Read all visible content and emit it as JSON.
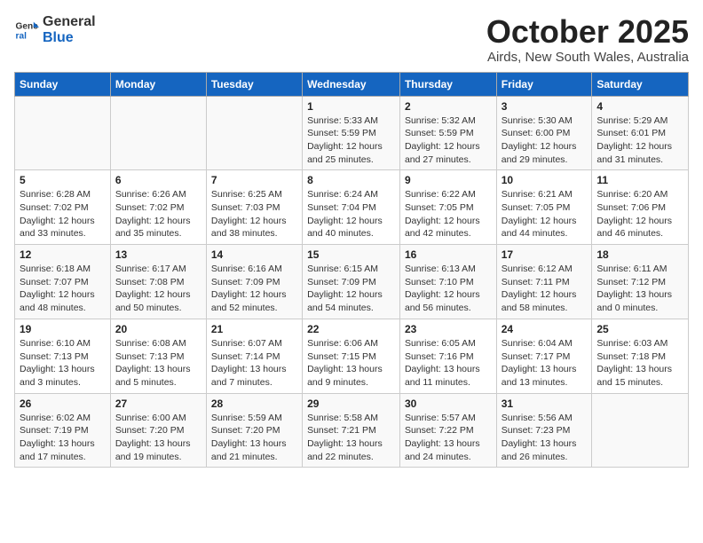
{
  "header": {
    "logo_line1": "General",
    "logo_line2": "Blue",
    "month": "October 2025",
    "location": "Airds, New South Wales, Australia"
  },
  "weekdays": [
    "Sunday",
    "Monday",
    "Tuesday",
    "Wednesday",
    "Thursday",
    "Friday",
    "Saturday"
  ],
  "weeks": [
    [
      {
        "day": "",
        "detail": ""
      },
      {
        "day": "",
        "detail": ""
      },
      {
        "day": "",
        "detail": ""
      },
      {
        "day": "1",
        "detail": "Sunrise: 5:33 AM\nSunset: 5:59 PM\nDaylight: 12 hours\nand 25 minutes."
      },
      {
        "day": "2",
        "detail": "Sunrise: 5:32 AM\nSunset: 5:59 PM\nDaylight: 12 hours\nand 27 minutes."
      },
      {
        "day": "3",
        "detail": "Sunrise: 5:30 AM\nSunset: 6:00 PM\nDaylight: 12 hours\nand 29 minutes."
      },
      {
        "day": "4",
        "detail": "Sunrise: 5:29 AM\nSunset: 6:01 PM\nDaylight: 12 hours\nand 31 minutes."
      }
    ],
    [
      {
        "day": "5",
        "detail": "Sunrise: 6:28 AM\nSunset: 7:02 PM\nDaylight: 12 hours\nand 33 minutes."
      },
      {
        "day": "6",
        "detail": "Sunrise: 6:26 AM\nSunset: 7:02 PM\nDaylight: 12 hours\nand 35 minutes."
      },
      {
        "day": "7",
        "detail": "Sunrise: 6:25 AM\nSunset: 7:03 PM\nDaylight: 12 hours\nand 38 minutes."
      },
      {
        "day": "8",
        "detail": "Sunrise: 6:24 AM\nSunset: 7:04 PM\nDaylight: 12 hours\nand 40 minutes."
      },
      {
        "day": "9",
        "detail": "Sunrise: 6:22 AM\nSunset: 7:05 PM\nDaylight: 12 hours\nand 42 minutes."
      },
      {
        "day": "10",
        "detail": "Sunrise: 6:21 AM\nSunset: 7:05 PM\nDaylight: 12 hours\nand 44 minutes."
      },
      {
        "day": "11",
        "detail": "Sunrise: 6:20 AM\nSunset: 7:06 PM\nDaylight: 12 hours\nand 46 minutes."
      }
    ],
    [
      {
        "day": "12",
        "detail": "Sunrise: 6:18 AM\nSunset: 7:07 PM\nDaylight: 12 hours\nand 48 minutes."
      },
      {
        "day": "13",
        "detail": "Sunrise: 6:17 AM\nSunset: 7:08 PM\nDaylight: 12 hours\nand 50 minutes."
      },
      {
        "day": "14",
        "detail": "Sunrise: 6:16 AM\nSunset: 7:09 PM\nDaylight: 12 hours\nand 52 minutes."
      },
      {
        "day": "15",
        "detail": "Sunrise: 6:15 AM\nSunset: 7:09 PM\nDaylight: 12 hours\nand 54 minutes."
      },
      {
        "day": "16",
        "detail": "Sunrise: 6:13 AM\nSunset: 7:10 PM\nDaylight: 12 hours\nand 56 minutes."
      },
      {
        "day": "17",
        "detail": "Sunrise: 6:12 AM\nSunset: 7:11 PM\nDaylight: 12 hours\nand 58 minutes."
      },
      {
        "day": "18",
        "detail": "Sunrise: 6:11 AM\nSunset: 7:12 PM\nDaylight: 13 hours\nand 0 minutes."
      }
    ],
    [
      {
        "day": "19",
        "detail": "Sunrise: 6:10 AM\nSunset: 7:13 PM\nDaylight: 13 hours\nand 3 minutes."
      },
      {
        "day": "20",
        "detail": "Sunrise: 6:08 AM\nSunset: 7:13 PM\nDaylight: 13 hours\nand 5 minutes."
      },
      {
        "day": "21",
        "detail": "Sunrise: 6:07 AM\nSunset: 7:14 PM\nDaylight: 13 hours\nand 7 minutes."
      },
      {
        "day": "22",
        "detail": "Sunrise: 6:06 AM\nSunset: 7:15 PM\nDaylight: 13 hours\nand 9 minutes."
      },
      {
        "day": "23",
        "detail": "Sunrise: 6:05 AM\nSunset: 7:16 PM\nDaylight: 13 hours\nand 11 minutes."
      },
      {
        "day": "24",
        "detail": "Sunrise: 6:04 AM\nSunset: 7:17 PM\nDaylight: 13 hours\nand 13 minutes."
      },
      {
        "day": "25",
        "detail": "Sunrise: 6:03 AM\nSunset: 7:18 PM\nDaylight: 13 hours\nand 15 minutes."
      }
    ],
    [
      {
        "day": "26",
        "detail": "Sunrise: 6:02 AM\nSunset: 7:19 PM\nDaylight: 13 hours\nand 17 minutes."
      },
      {
        "day": "27",
        "detail": "Sunrise: 6:00 AM\nSunset: 7:20 PM\nDaylight: 13 hours\nand 19 minutes."
      },
      {
        "day": "28",
        "detail": "Sunrise: 5:59 AM\nSunset: 7:20 PM\nDaylight: 13 hours\nand 21 minutes."
      },
      {
        "day": "29",
        "detail": "Sunrise: 5:58 AM\nSunset: 7:21 PM\nDaylight: 13 hours\nand 22 minutes."
      },
      {
        "day": "30",
        "detail": "Sunrise: 5:57 AM\nSunset: 7:22 PM\nDaylight: 13 hours\nand 24 minutes."
      },
      {
        "day": "31",
        "detail": "Sunrise: 5:56 AM\nSunset: 7:23 PM\nDaylight: 13 hours\nand 26 minutes."
      },
      {
        "day": "",
        "detail": ""
      }
    ]
  ]
}
